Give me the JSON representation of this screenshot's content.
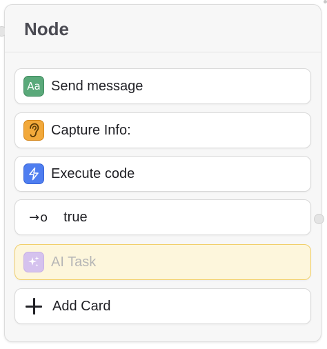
{
  "node": {
    "title": "Node"
  },
  "cards": {
    "send_message": {
      "label": "Send message",
      "icon": "text-aa-icon",
      "icon_text": "Aa",
      "color": "#5aa97a"
    },
    "capture_info": {
      "label": "Capture Info:",
      "icon": "ear-icon",
      "color": "#f2a93b"
    },
    "execute_code": {
      "label": "Execute code",
      "icon": "lightning-icon",
      "color": "#4f7ef0"
    },
    "route": {
      "label": "true",
      "icon": "arrow-to-port-icon",
      "glyph": "→o"
    },
    "ai_task": {
      "label": "AI Task",
      "icon": "sparkles-icon",
      "color": "#d5c2ee",
      "background": "#fdf6dc",
      "border": "#f1cf6a"
    },
    "add_card": {
      "label": "Add Card",
      "icon": "plus-icon"
    }
  }
}
